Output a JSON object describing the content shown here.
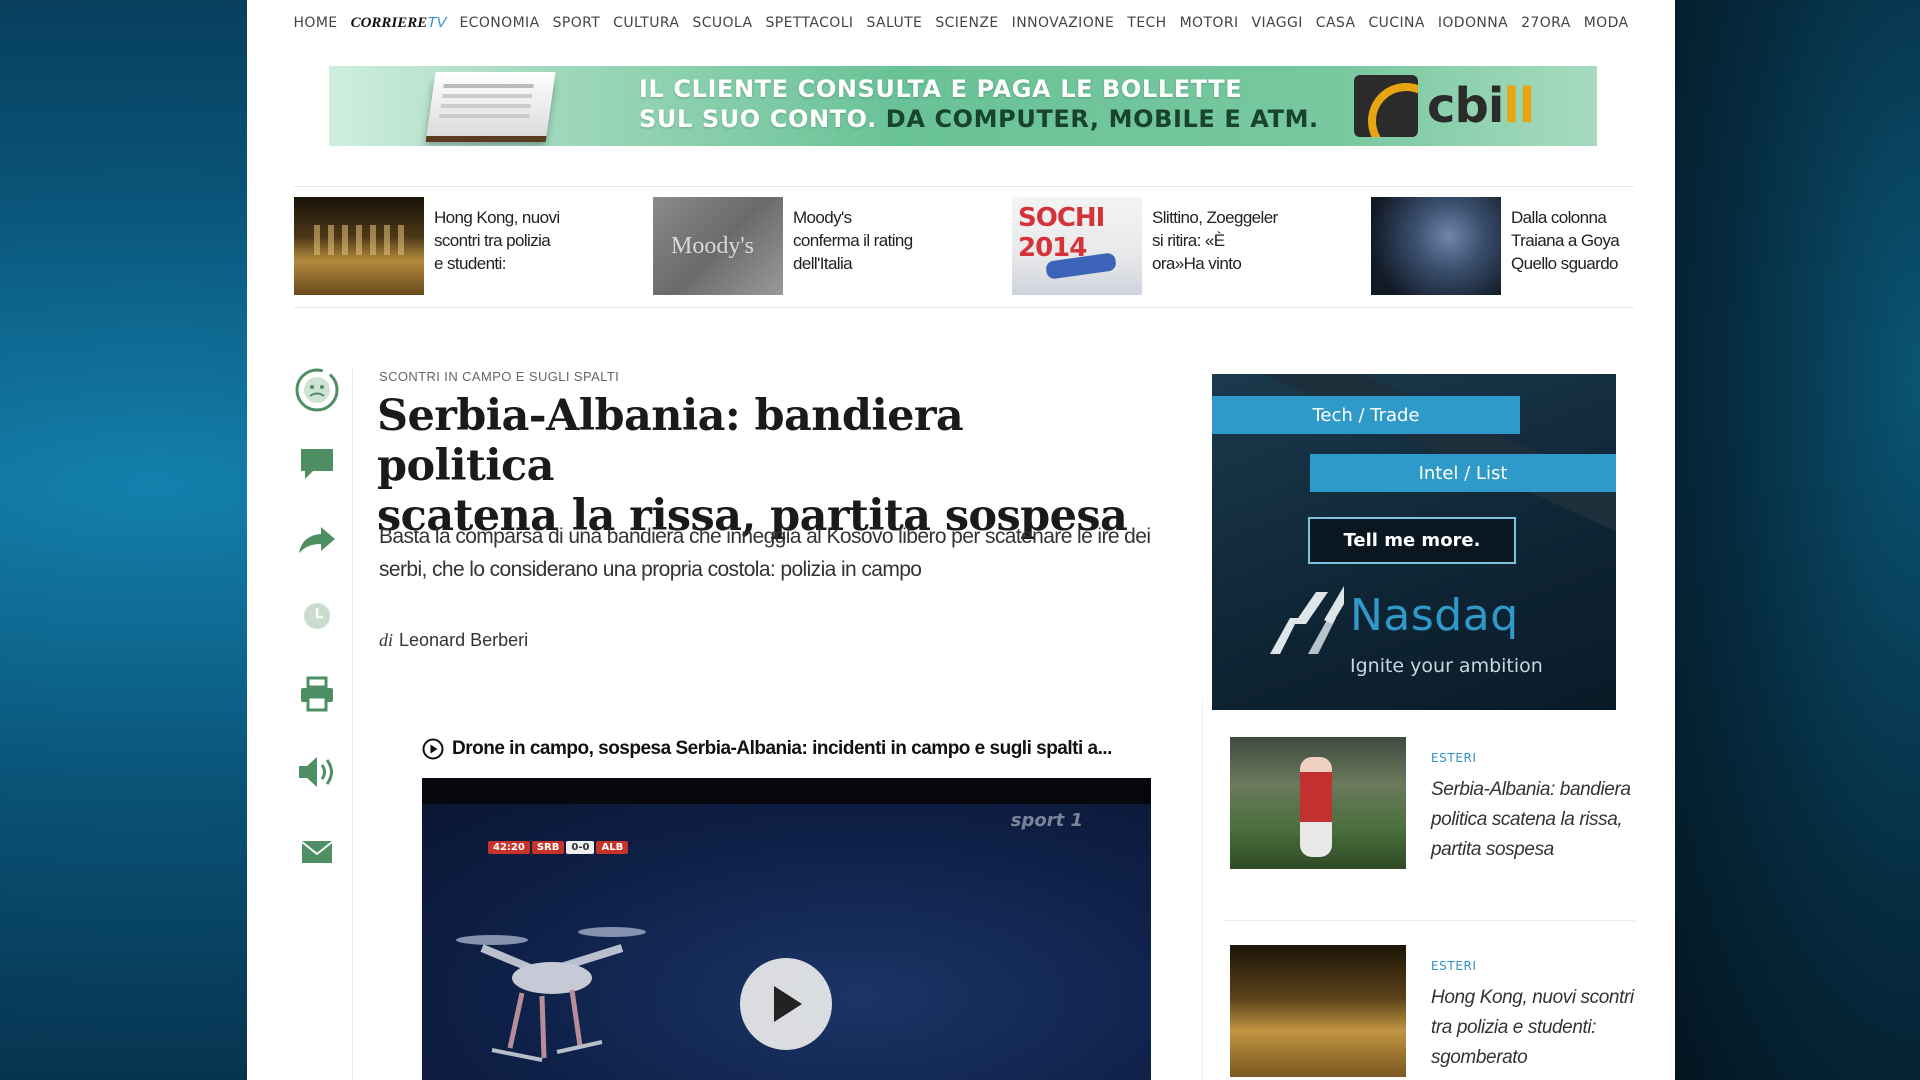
{
  "nav": {
    "items": [
      "HOME",
      "ECONOMIA",
      "SPORT",
      "CULTURA",
      "SCUOLA",
      "SPETTACOLI",
      "SALUTE",
      "SCIENZE",
      "INNOVAZIONE",
      "TECH",
      "MOTORI",
      "VIAGGI",
      "CASA",
      "CUCINA",
      "IODONNA",
      "27ORA",
      "MODA"
    ],
    "brand_main": "CORRIERE",
    "brand_suffix": "TV"
  },
  "banner": {
    "line1": "IL CLIENTE CONSULTA E PAGA LE BOLLETTE",
    "line2_a": "SUL SUO CONTO.",
    "line2_b": "DA COMPUTER, MOBILE E ATM.",
    "logo_a": "cbi",
    "logo_b": "ll"
  },
  "teasers": [
    {
      "title": "Hong Kong, nuovi scontri tra polizia e studenti:"
    },
    {
      "title": "Moody's conferma il rating dell'Italia",
      "thumb_text": "Moody's"
    },
    {
      "title": "Slittino, Zoeggeler si ritira: «È ora»Ha vinto",
      "thumb_text": "SOCHI 2014"
    },
    {
      "title": "Dalla colonna Traiana a Goya Quello sguardo"
    }
  ],
  "article": {
    "kicker": "SCONTRI IN CAMPO E SUGLI SPALTI",
    "headline_1": "Serbia-Albania: bandiera politica",
    "headline_2": "scatena la rissa, partita sospesa",
    "summary": "Basta la comparsa di una bandiera che inneggia al Kosovo libero per scatenare le ire dei serbi, che lo considerano una propria costola: polizia in campo",
    "byline_prefix": "di",
    "author": "Leonard Berberi"
  },
  "video": {
    "title": "Drone in campo, sospesa Serbia-Albania: incidenti in campo e sugli spalti a...",
    "score_time": "42:20",
    "score_home": "SRB",
    "score_value": "0-0",
    "score_away": "ALB",
    "channel": "sport 1"
  },
  "ad": {
    "pill1": "Tech / Trade",
    "pill2": "Intel / List",
    "cta": "Tell me more.",
    "brand": "Nasdaq",
    "tagline": "Ignite your ambition"
  },
  "related": [
    {
      "category": "ESTERI",
      "title": "Serbia-Albania: bandiera politica scatena la rissa, partita sospesa"
    },
    {
      "category": "ESTERI",
      "title": "Hong Kong, nuovi scontri tra polizia e studenti: sgomberato"
    }
  ],
  "colors": {
    "accent_blue": "#2e93c9",
    "share_icon_green": "#4f8f64",
    "nasdaq_blue": "#2f9ac9"
  }
}
